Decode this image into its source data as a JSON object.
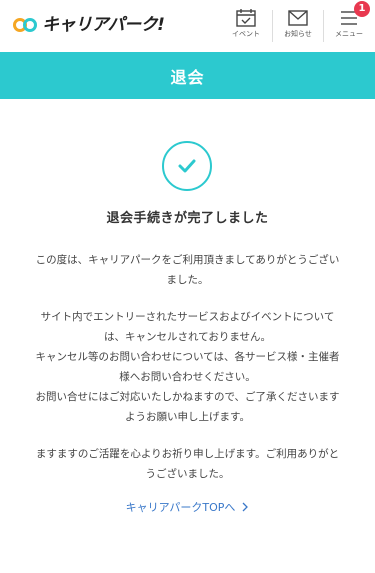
{
  "header": {
    "logo_text": "キャリアパーク!",
    "nav": [
      {
        "label": "イベント",
        "icon": "calendar-icon"
      },
      {
        "label": "お知らせ",
        "icon": "mail-icon"
      },
      {
        "label": "メニュー",
        "icon": "hamburger-menu-icon",
        "badge": "1"
      }
    ]
  },
  "title_bar": {
    "title": "退会"
  },
  "main": {
    "heading": "退会手続きが完了しました",
    "paragraphs": [
      [
        "この度は、キャリアパークをご利用頂きましてありがとうござい",
        "ました。"
      ],
      [
        "サイト内でエントリーされたサービスおよびイベントについて",
        "は、キャンセルされておりません。",
        "キャンセル等のお問い合わせについては、各サービス様・主催者",
        "様へお問い合わせください。",
        "お問い合せにはご対応いたしかねますので、ご了承くださいます",
        "ようお願い申し上げます。"
      ],
      [
        "ますますのご活躍を心よりお祈り申し上げます。ご利用ありがと",
        "うございました。"
      ]
    ],
    "top_link": "キャリアパークTOPへ"
  },
  "colors": {
    "accent": "#2cc9cf",
    "badge": "#e8384f",
    "link": "#3a78c9"
  }
}
